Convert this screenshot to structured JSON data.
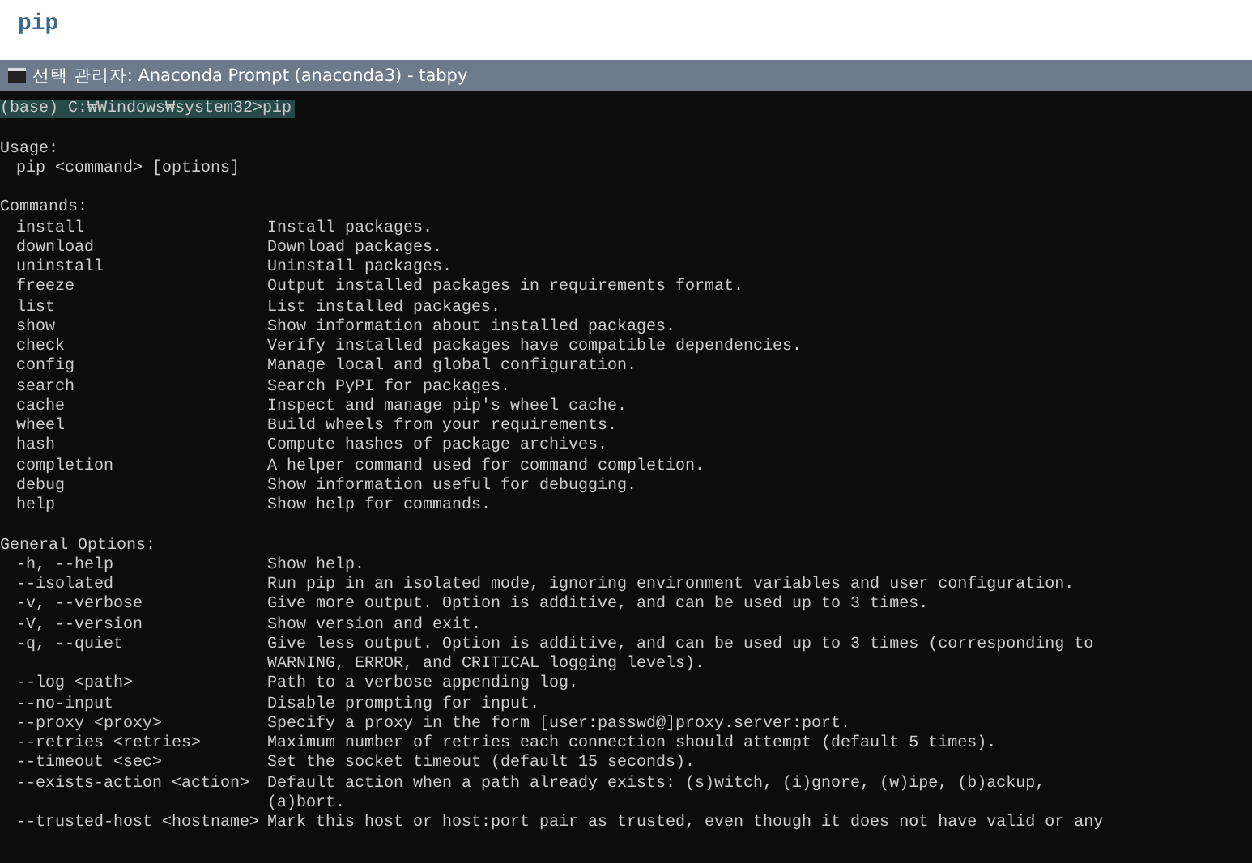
{
  "heading": "pip",
  "window": {
    "title": "선택 관리자: Anaconda Prompt (anaconda3) - tabpy"
  },
  "prompt": {
    "text": "(base) C:₩Windows₩system32>pip",
    "selected": true
  },
  "usage": {
    "label": "Usage:",
    "line": "pip <command> [options]"
  },
  "commands": {
    "label": "Commands:",
    "rows": [
      {
        "name": "install",
        "lines": [
          "Install packages."
        ]
      },
      {
        "name": "download",
        "lines": [
          "Download packages."
        ]
      },
      {
        "name": "uninstall",
        "lines": [
          "Uninstall packages."
        ]
      },
      {
        "name": "freeze",
        "lines": [
          "Output installed packages in requirements format."
        ]
      },
      {
        "name": "list",
        "lines": [
          "List installed packages."
        ]
      },
      {
        "name": "show",
        "lines": [
          "Show information about installed packages."
        ]
      },
      {
        "name": "check",
        "lines": [
          "Verify installed packages have compatible dependencies."
        ]
      },
      {
        "name": "config",
        "lines": [
          "Manage local and global configuration."
        ]
      },
      {
        "name": "search",
        "lines": [
          "Search PyPI for packages."
        ]
      },
      {
        "name": "cache",
        "lines": [
          "Inspect and manage pip's wheel cache."
        ]
      },
      {
        "name": "wheel",
        "lines": [
          "Build wheels from your requirements."
        ]
      },
      {
        "name": "hash",
        "lines": [
          "Compute hashes of package archives."
        ]
      },
      {
        "name": "completion",
        "lines": [
          "A helper command used for command completion."
        ]
      },
      {
        "name": "debug",
        "lines": [
          "Show information useful for debugging."
        ]
      },
      {
        "name": "help",
        "lines": [
          "Show help for commands."
        ]
      }
    ]
  },
  "general_options": {
    "label": "General Options:",
    "rows": [
      {
        "name": "-h, --help",
        "lines": [
          "Show help."
        ]
      },
      {
        "name": "--isolated",
        "lines": [
          "Run pip in an isolated mode, ignoring environment variables and user configuration."
        ]
      },
      {
        "name": "-v, --verbose",
        "lines": [
          "Give more output. Option is additive, and can be used up to 3 times."
        ]
      },
      {
        "name": "-V, --version",
        "lines": [
          "Show version and exit."
        ]
      },
      {
        "name": "-q, --quiet",
        "lines": [
          "Give less output. Option is additive, and can be used up to 3 times (corresponding to",
          "WARNING, ERROR, and CRITICAL logging levels)."
        ]
      },
      {
        "name": "--log <path>",
        "lines": [
          "Path to a verbose appending log."
        ]
      },
      {
        "name": "--no-input",
        "lines": [
          "Disable prompting for input."
        ]
      },
      {
        "name": "--proxy <proxy>",
        "lines": [
          "Specify a proxy in the form [user:passwd@]proxy.server:port."
        ]
      },
      {
        "name": "--retries <retries>",
        "lines": [
          "Maximum number of retries each connection should attempt (default 5 times)."
        ]
      },
      {
        "name": "--timeout <sec>",
        "lines": [
          "Set the socket timeout (default 15 seconds)."
        ]
      },
      {
        "name": "--exists-action <action>",
        "lines": [
          "Default action when a path already exists: (s)witch, (i)gnore, (w)ipe, (b)ackup,",
          "(a)bort."
        ]
      },
      {
        "name": "--trusted-host <hostname>",
        "lines": [
          "Mark this host or host:port pair as trusted, even though it does not have valid or any"
        ]
      }
    ]
  }
}
